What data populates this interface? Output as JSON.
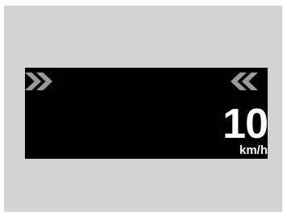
{
  "display": {
    "speed_value": "10",
    "speed_unit": "km/h",
    "left_indicator_icon": "double-chevron-right-icon",
    "right_indicator_icon": "double-chevron-left-icon"
  },
  "colors": {
    "panel_background": "#d3d3d3",
    "display_background": "#000000",
    "chevron": "#9a9a9a",
    "text": "#ffffff"
  }
}
